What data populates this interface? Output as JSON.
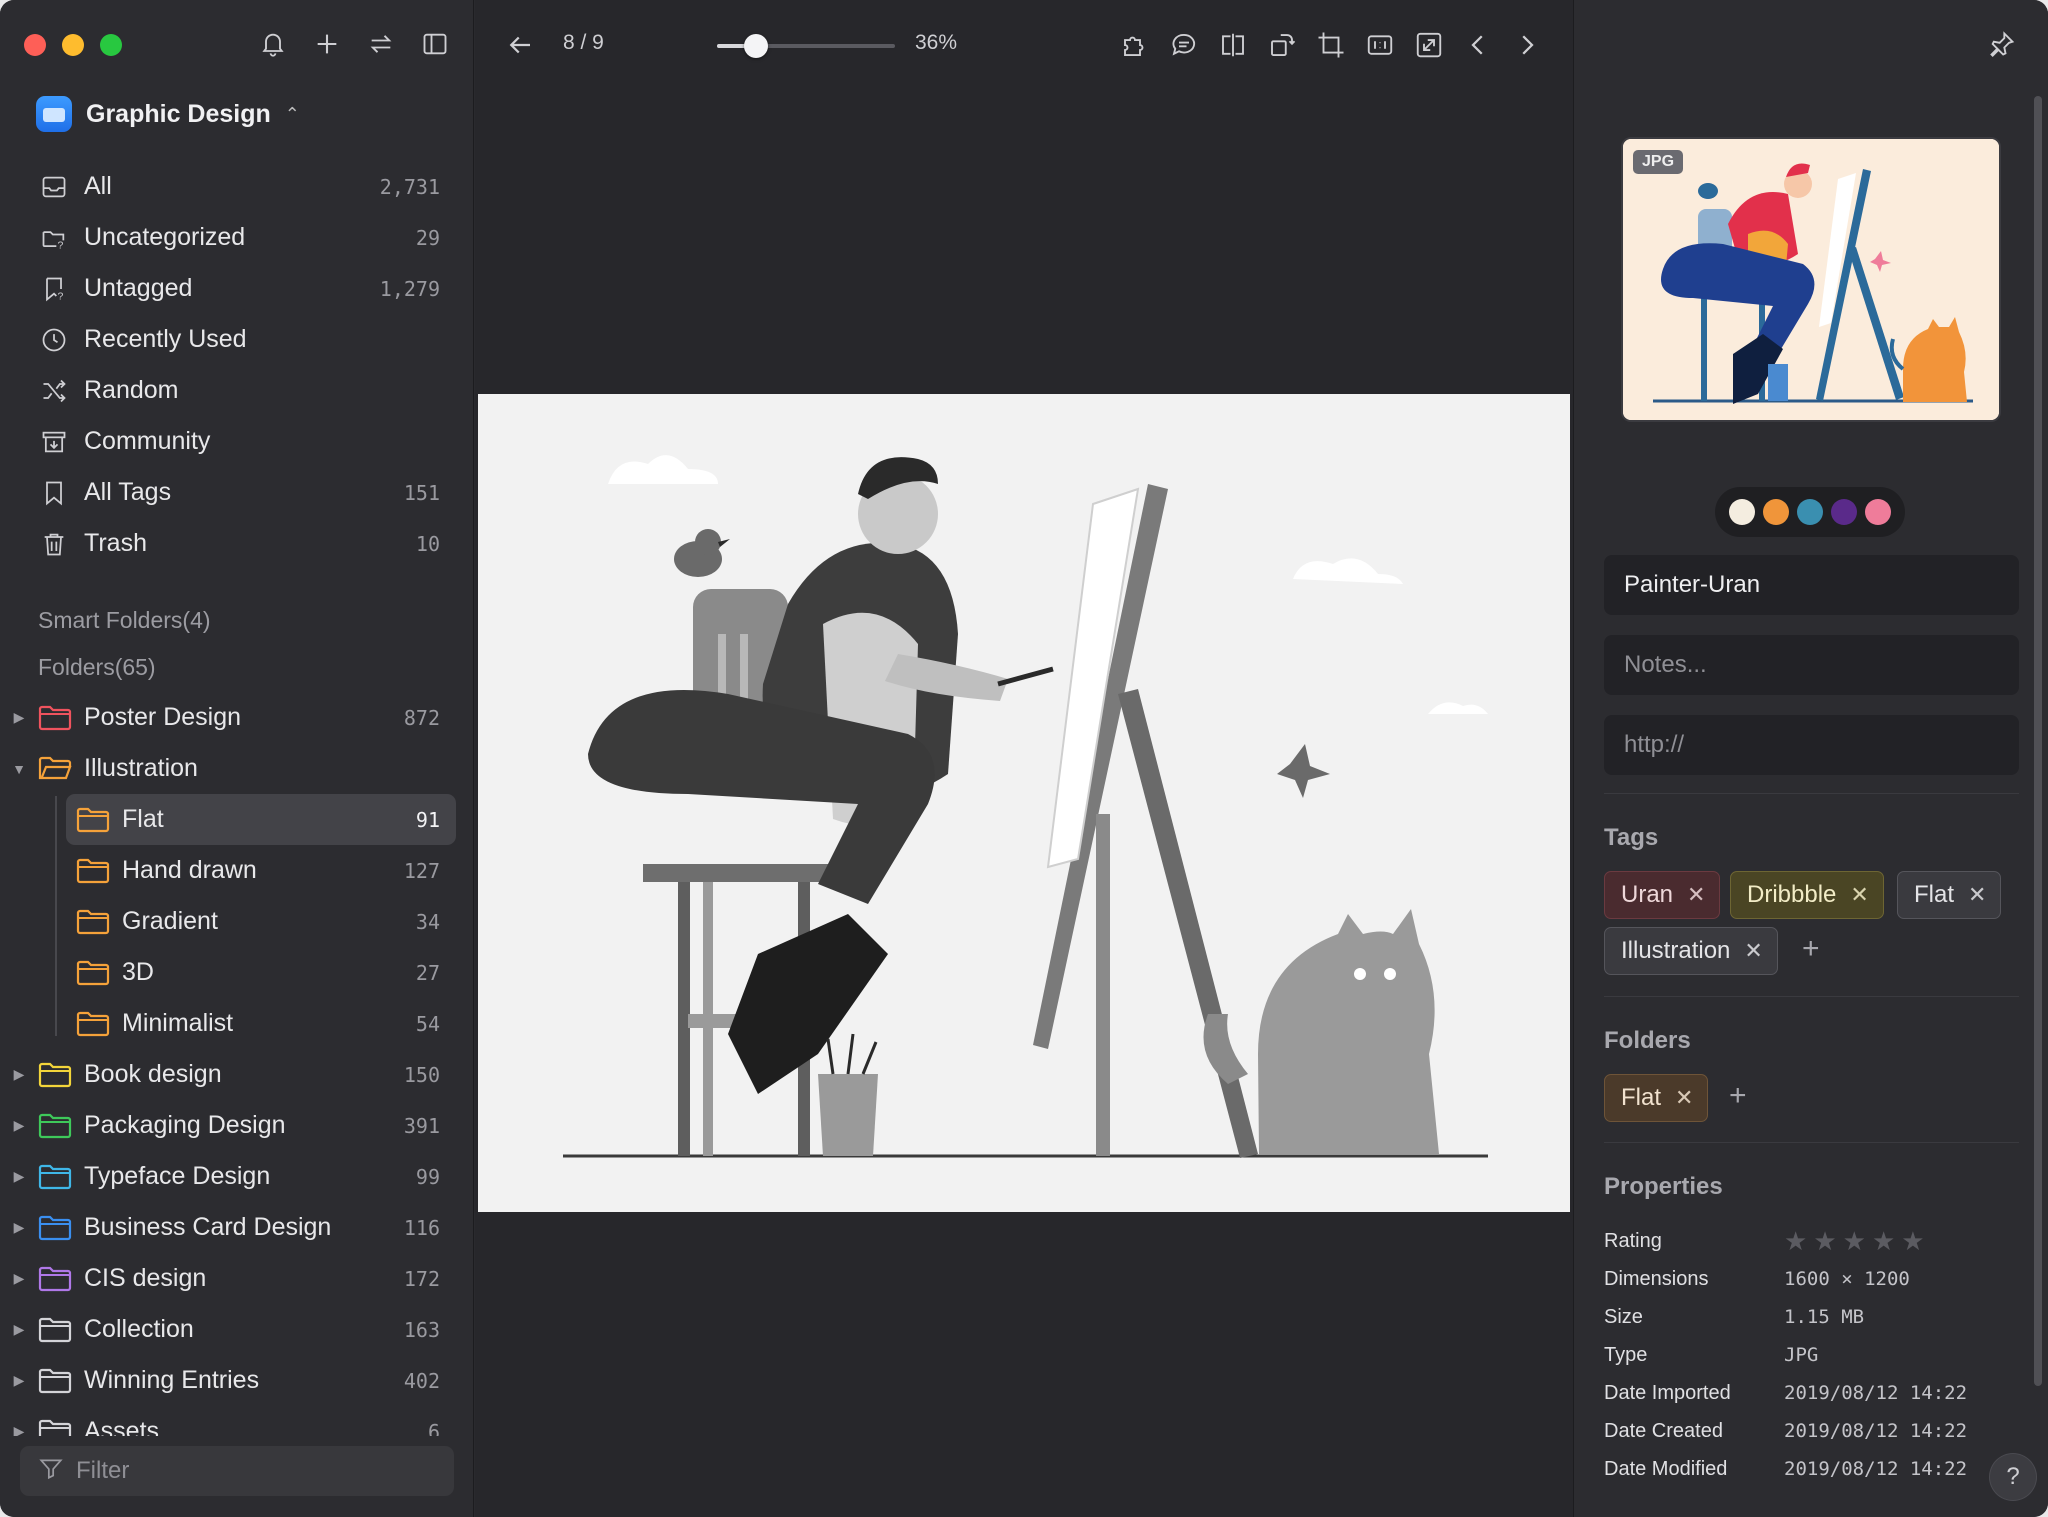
{
  "sidebar": {
    "library_name": "Graphic Design",
    "nav": [
      {
        "label": "All",
        "count": "2,731",
        "icon": "inbox-icon"
      },
      {
        "label": "Uncategorized",
        "count": "29",
        "icon": "folder-question-icon"
      },
      {
        "label": "Untagged",
        "count": "1,279",
        "icon": "tag-question-icon"
      },
      {
        "label": "Recently Used",
        "count": "",
        "icon": "clock-icon"
      },
      {
        "label": "Random",
        "count": "",
        "icon": "shuffle-icon"
      },
      {
        "label": "Community",
        "count": "",
        "icon": "archive-download-icon"
      },
      {
        "label": "All Tags",
        "count": "151",
        "icon": "bookmark-icon"
      },
      {
        "label": "Trash",
        "count": "10",
        "icon": "trash-icon"
      }
    ],
    "smart_folders_label": "Smart Folders(4)",
    "folders_label": "Folders(65)",
    "folders": [
      {
        "label": "Poster Design",
        "count": "872",
        "color": "#f0535e"
      },
      {
        "label": "Illustration",
        "count": "",
        "color": "#f5a23a"
      },
      {
        "label": "Flat",
        "count": "91",
        "color": "#f5a23a"
      },
      {
        "label": "Hand drawn",
        "count": "127",
        "color": "#f5a23a"
      },
      {
        "label": "Gradient",
        "count": "34",
        "color": "#f5a23a"
      },
      {
        "label": "3D",
        "count": "27",
        "color": "#f5a23a"
      },
      {
        "label": "Minimalist",
        "count": "54",
        "color": "#f5a23a"
      },
      {
        "label": "Book design",
        "count": "150",
        "color": "#f3d53a"
      },
      {
        "label": "Packaging Design",
        "count": "391",
        "color": "#3ec95a"
      },
      {
        "label": "Typeface Design",
        "count": "99",
        "color": "#3fb7e8"
      },
      {
        "label": "Business Card Design",
        "count": "116",
        "color": "#3a8ff0"
      },
      {
        "label": "CIS design",
        "count": "172",
        "color": "#b078e8"
      },
      {
        "label": "Collection",
        "count": "163",
        "color": "#d4d4d8"
      },
      {
        "label": "Winning Entries",
        "count": "402",
        "color": "#d4d4d8"
      },
      {
        "label": "Assets",
        "count": "6",
        "color": "#d4d4d8"
      }
    ],
    "filter_placeholder": "Filter"
  },
  "viewer": {
    "page": "8 / 9",
    "zoom": "36%",
    "zoom_fraction": 0.22
  },
  "inspector": {
    "thumb_badge": "JPG",
    "palette": [
      "#f4ede0",
      "#f0953a",
      "#3a8fb0",
      "#5a2a8a",
      "#ef7c9a"
    ],
    "name": "Painter-Uran",
    "notes_placeholder": "Notes...",
    "url_placeholder": "http://",
    "tags_title": "Tags",
    "tags": [
      "Uran",
      "Dribbble",
      "Flat",
      "Illustration"
    ],
    "folders_title": "Folders",
    "folder_tag": "Flat",
    "properties_title": "Properties",
    "props": [
      {
        "key": "Rating",
        "value": ""
      },
      {
        "key": "Dimensions",
        "value": "1600 × 1200"
      },
      {
        "key": "Size",
        "value": "1.15 MB"
      },
      {
        "key": "Type",
        "value": "JPG"
      },
      {
        "key": "Date Imported",
        "value": "2019/08/12 14:22"
      },
      {
        "key": "Date Created",
        "value": "2019/08/12 14:22"
      },
      {
        "key": "Date Modified",
        "value": "2019/08/12 14:22"
      }
    ],
    "rating": 0,
    "help": "?"
  }
}
